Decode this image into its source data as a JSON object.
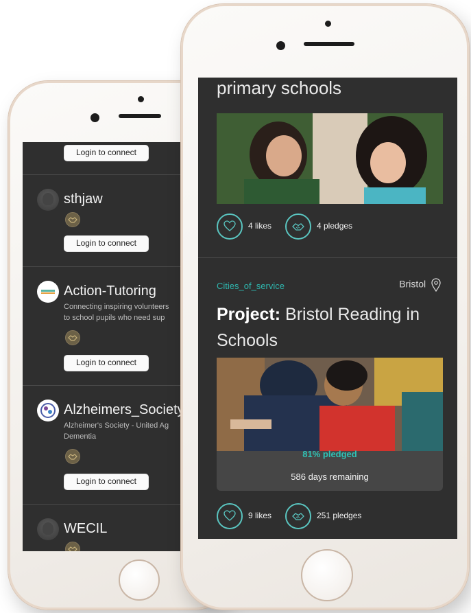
{
  "left_phone": {
    "items": [
      {
        "name": "",
        "description": "",
        "login_label": "Login to connect"
      },
      {
        "name": "sthjaw",
        "description": "",
        "login_label": "Login to connect"
      },
      {
        "name": "Action-Tutoring",
        "description_line1": "Connecting inspiring volunteers",
        "description_line2": "to school pupils who need sup",
        "login_label": "Login to connect"
      },
      {
        "name": "Alzheimers_Society",
        "description_line1": "Alzheimer's Society - United Ag",
        "description_line2": "Dementia",
        "login_label": "Login to connect"
      },
      {
        "name": "WECIL"
      }
    ]
  },
  "right_phone": {
    "top_card": {
      "title_fragment": "primary schools",
      "likes": "4 likes",
      "pledges": "4 pledges"
    },
    "project_card": {
      "category": "Cities_of_service",
      "location": "Bristol",
      "title_prefix": "Project:",
      "title": "Bristol Reading in Schools",
      "pledged_percent_label": "81% pledged",
      "pledged_fraction": 0.81,
      "days_remaining": "586 days remaining",
      "likes": "9 likes",
      "pledges": "251 pledges"
    }
  },
  "colors": {
    "screen_bg": "#2f2f2f",
    "accent_teal": "#2fb5ad",
    "phone_frame": "#e7d7c9"
  },
  "icons": [
    "heart-icon",
    "handshake-icon",
    "location-pin-icon"
  ]
}
